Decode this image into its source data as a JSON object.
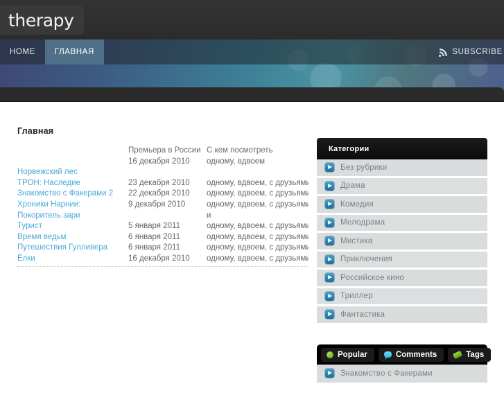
{
  "header": {
    "logo_text": "therapy",
    "nav": [
      {
        "label": "HOME",
        "active": false
      },
      {
        "label": "ГЛАВНАЯ",
        "active": true
      }
    ],
    "subscribe_label": "SUBSCRIBE",
    "rss_icon": "rss-icon"
  },
  "main": {
    "page_title": "Главная",
    "table": {
      "headers": [
        "",
        "Премьера в России",
        "С кем посмотреть"
      ],
      "rows": [
        {
          "title": "",
          "premiere": "16 декабря 2010",
          "watch_with": "одному, вдвоем"
        },
        {
          "title": "Норвежский лес",
          "premiere": "",
          "watch_with": ""
        },
        {
          "title": "ТРОН: Наследие",
          "premiere": "23 декабря 2010",
          "watch_with": "одному, вдвоем, с друзьями"
        },
        {
          "title": "Знакомство с Факерами 2",
          "premiere": "22 декабря 2010",
          "watch_with": "одному, вдвоем, с друзьями"
        },
        {
          "title": "Хроники Нарнии:",
          "premiere": "9 декабря 2010",
          "watch_with": "одному, вдвоем, с друзьями, с"
        },
        {
          "title": "Покоритель зари",
          "premiere": "",
          "watch_with": "и"
        },
        {
          "title": "Турист",
          "premiere": "5 января 2011",
          "watch_with": "одному, вдвоем, с друзьями"
        },
        {
          "title": "Время ведьм",
          "premiere": "6 января 2011",
          "watch_with": "одному, вдвоем, с друзьями"
        },
        {
          "title": "Путешествия Гулливера",
          "premiere": "6 января 2011",
          "watch_with": "одному, вдвоем, с друзьями"
        },
        {
          "title": "Ёлки",
          "premiere": "16 декабря 2010",
          "watch_with": "одному, вдвоем, с друзьями"
        }
      ]
    }
  },
  "sidebar": {
    "categories": {
      "title": "Категории",
      "items": [
        {
          "label": "Без рубрики",
          "icon": "arrow-right-icon"
        },
        {
          "label": "Драма",
          "icon": "arrow-right-icon"
        },
        {
          "label": "Комедия",
          "icon": "arrow-right-icon"
        },
        {
          "label": "Мелодрама",
          "icon": "arrow-right-icon"
        },
        {
          "label": "Мистика",
          "icon": "arrow-right-icon"
        },
        {
          "label": "Приключения",
          "icon": "arrow-right-icon"
        },
        {
          "label": "Российское кино",
          "icon": "arrow-right-icon"
        },
        {
          "label": "Триллер",
          "icon": "arrow-right-icon"
        },
        {
          "label": "Фантастика",
          "icon": "arrow-right-icon"
        }
      ]
    },
    "tabs_widget": {
      "tabs": [
        {
          "label": "Popular",
          "icon": "green-dot-icon",
          "active": true
        },
        {
          "label": "Comments",
          "icon": "speech-bubble-icon",
          "active": false
        },
        {
          "label": "Tags",
          "icon": "tag-icon",
          "active": false
        }
      ],
      "first_item_label": "Знакомство с Факерами"
    }
  },
  "colors": {
    "link_blue": "#4aa8d8",
    "icon_blue": "#2f8dbd",
    "dark_bar": "#2c2b2b",
    "sidebar_row": "#d9dcdc",
    "accent_green": "#74b01c"
  }
}
